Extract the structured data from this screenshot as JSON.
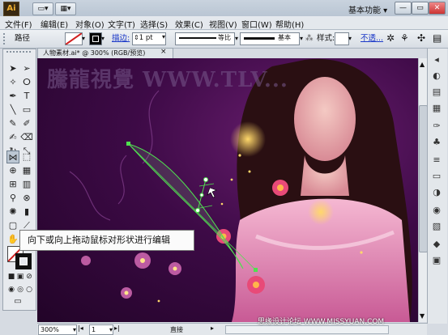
{
  "app": {
    "logo": "Ai",
    "workspace": "基本功能 ▾"
  },
  "titlebar_icons": [
    "▭▾",
    "▦▾"
  ],
  "window_buttons": [
    "—",
    "▭",
    "✕"
  ],
  "menu": [
    "文件(F)",
    "编辑(E)",
    "对象(O)",
    "文字(T)",
    "选择(S)",
    "效果(C)",
    "视图(V)",
    "窗口(W)",
    "帮助(H)"
  ],
  "control": {
    "path_label": "路径",
    "stroke_label": "描边:",
    "stroke_weight": "1 pt",
    "profile_label": "等比",
    "brush_label": "基本",
    "style_label": "样式:",
    "opacity_label": "不透...",
    "colors": {
      "stroke_link": "#1a38c8",
      "accent": "#d02020"
    }
  },
  "document": {
    "tab": "人物素材.ai* @ 300% (RGB/预览)",
    "close": "×"
  },
  "canvas": {
    "watermark": "騰龍視覺 WWW.TLV..."
  },
  "callout": {
    "text": "向下或向上拖动鼠标对形状进行编辑"
  },
  "statusbar": {
    "zoom": "300%",
    "page": "1",
    "tool": "直接",
    "footer": "思缘设计论坛 WWW.MISSYUAN.COM"
  }
}
